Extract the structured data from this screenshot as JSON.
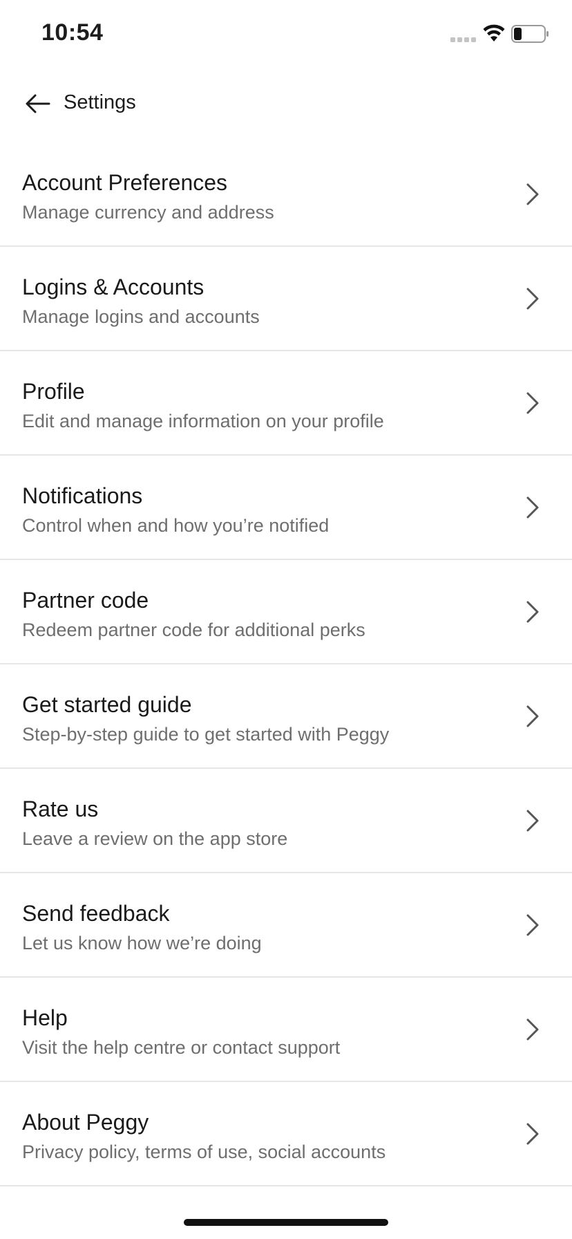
{
  "status_bar": {
    "time": "10:54"
  },
  "header": {
    "title": "Settings",
    "back_icon": "arrow-left-icon"
  },
  "settings_items": [
    {
      "title": "Account Preferences",
      "subtitle": "Manage currency and address"
    },
    {
      "title": "Logins & Accounts",
      "subtitle": "Manage logins and accounts"
    },
    {
      "title": "Profile",
      "subtitle": "Edit and manage information on your profile"
    },
    {
      "title": "Notifications",
      "subtitle": "Control when and how you’re notified"
    },
    {
      "title": "Partner code",
      "subtitle": "Redeem partner code for additional perks"
    },
    {
      "title": "Get started guide",
      "subtitle": "Step-by-step guide to get started with Peggy"
    },
    {
      "title": "Rate us",
      "subtitle": "Leave a review on the app store"
    },
    {
      "title": "Send feedback",
      "subtitle": "Let us know how we’re doing"
    },
    {
      "title": "Help",
      "subtitle": "Visit the help centre or contact support"
    },
    {
      "title": "About Peggy",
      "subtitle": "Privacy policy, terms of use, social accounts"
    }
  ],
  "colors": {
    "title_text": "#1a1a1a",
    "subtitle_text": "#6e6e6e",
    "divider": "#e6e6e6",
    "chevron": "#555555"
  }
}
